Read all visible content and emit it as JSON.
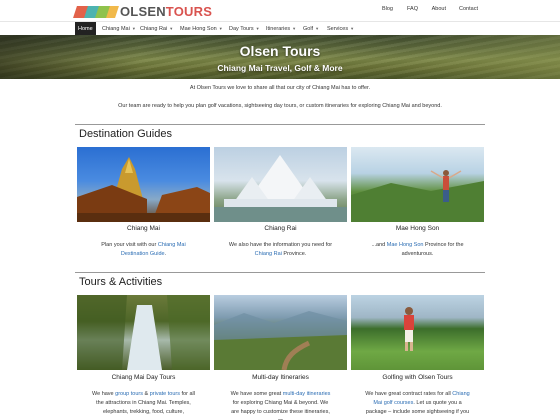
{
  "header": {
    "logo_text_part1": "OLSEN",
    "logo_text_part2": "TOURS",
    "topnav": [
      "Blog",
      "FAQ",
      "About",
      "Contact"
    ]
  },
  "mainnav": {
    "items": [
      {
        "label": "Home",
        "caret": false
      },
      {
        "label": "Chiang Mai",
        "caret": true
      },
      {
        "label": "Chiang Rai",
        "caret": true
      },
      {
        "label": "Mae Hong Son",
        "caret": true
      },
      {
        "label": "Day Tours",
        "caret": true
      },
      {
        "label": "Itineraries",
        "caret": true
      },
      {
        "label": "Golf",
        "caret": true
      },
      {
        "label": "Services",
        "caret": true
      }
    ],
    "caret_glyph": "▼"
  },
  "hero": {
    "title": "Olsen Tours",
    "subtitle": "Chiang Mai Travel, Golf & More"
  },
  "intro": {
    "line1": "At Olsen Tours we love to share all that our city of Chiang Mai has to offer.",
    "line2": "Our team are ready to help you plan golf vacations, sightseeing day tours, or custom itineraries for exploring Chiang Mai and beyond."
  },
  "destinations": {
    "title": "Destination Guides",
    "cards": [
      {
        "title": "Chiang Mai",
        "text_before": "Plan your visit with our ",
        "link": "Chiang Mai Destination Guide",
        "text_after": "."
      },
      {
        "title": "Chiang Rai",
        "text_before": "We also have the information you need for ",
        "link": "Chiang Rai",
        "text_after": " Province."
      },
      {
        "title": "Mae Hong Son",
        "text_before": "...and ",
        "link": "Mae Hong Son",
        "text_after": " Province for the adventurous."
      }
    ]
  },
  "tours": {
    "title": "Tours & Activities",
    "cards": [
      {
        "title": "Chiang Mai Day Tours",
        "text_before": "We have ",
        "link1": "group tours",
        "mid": " & ",
        "link2": "private tours",
        "text_after": " for all the attractions in Chiang Mai. Temples, elephants, trekking, food, culture,"
      },
      {
        "title": "Multi-day Itineraries",
        "text_before": "We have some great ",
        "link": "multi-day itineraries",
        "text_after": " for exploring Chiang Mai & beyond. We are happy to customize these itineraries, or"
      },
      {
        "title": "Golfing with Olsen Tours",
        "text_before": "We have great contract rates for all ",
        "link": "Chiang Mai golf courses",
        "text_after": ". Let us quote you a package – include some sightseeing if you"
      }
    ]
  },
  "colors": {
    "logo_red": "#e2624a",
    "logo_teal": "#4db3b0",
    "logo_green": "#8fc24c",
    "logo_yellow": "#f1b94b",
    "link_blue": "#2a6cb3",
    "nav_active_bg": "#222222"
  }
}
